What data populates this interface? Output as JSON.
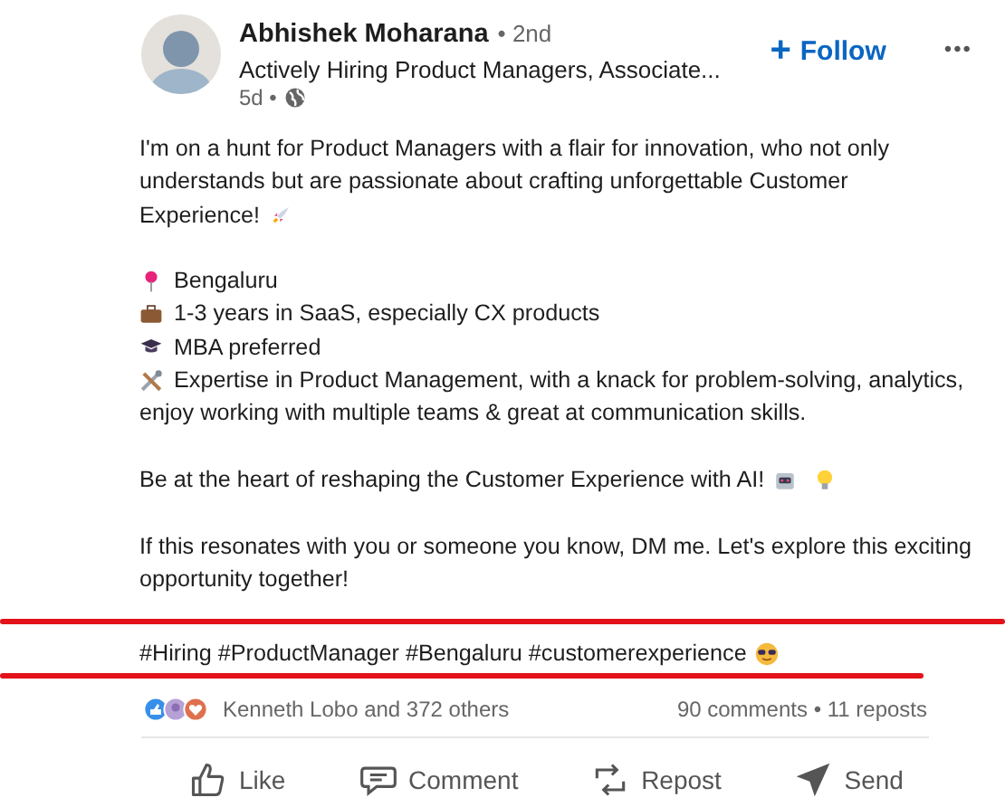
{
  "author": {
    "name": "Abhishek Moharana",
    "degree": "• 2nd",
    "headline": "Actively Hiring Product Managers, Associate...",
    "time": "5d •"
  },
  "follow_button": {
    "label": "Follow",
    "icon": "+"
  },
  "menu_button": {
    "label": "•••"
  },
  "paragraphs": [
    {
      "lines": [
        {
          "kind": "text",
          "text": "I'm on a hunt for Product Managers with a flair for innovation, who not only"
        },
        {
          "kind": "text",
          "text": "understands but are passionate about crafting unforgettable Customer"
        },
        {
          "kind": "text",
          "text": "Experience!"
        }
      ]
    },
    {
      "lines": [
        {
          "kind": "bullet",
          "text": "Bengaluru"
        },
        {
          "kind": "bullet",
          "text": "1-3 years in SaaS, especially CX products"
        },
        {
          "kind": "bullet",
          "text": "MBA preferred"
        },
        {
          "kind": "bullet",
          "text": "Expertise in Product Management, with a knack for problem-solving, analytics,"
        },
        {
          "kind": "text",
          "text": "enjoy working with multiple teams & great at communication skills."
        }
      ]
    },
    {
      "lines": [
        {
          "kind": "text",
          "text": "Be at the heart of reshaping the Customer Experience with AI!"
        }
      ]
    },
    {
      "lines": [
        {
          "kind": "text",
          "text": "If this resonates with you or someone you know, DM me. Let's explore this exciting"
        },
        {
          "kind": "text",
          "text": "opportunity together!"
        }
      ]
    }
  ],
  "hashtags": {
    "text": "#Hiring #ProductManager #Bengaluru #customerexperience"
  },
  "reactions": {
    "text": "Kenneth Lobo and 372 others",
    "stats": "90 comments • 11 reposts"
  },
  "actions": [
    {
      "kind": "like",
      "label": "Like"
    },
    {
      "kind": "comment",
      "label": "Comment"
    },
    {
      "kind": "repost",
      "label": "Repost"
    },
    {
      "kind": "send",
      "label": "Send"
    }
  ]
}
